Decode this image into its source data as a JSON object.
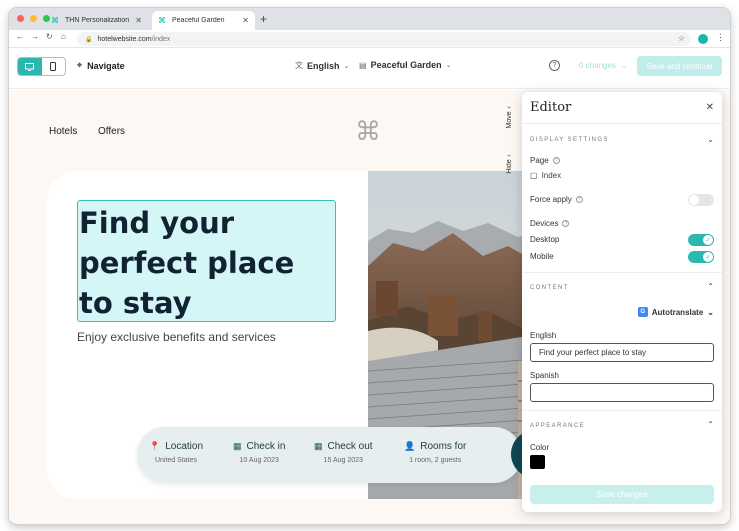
{
  "browser": {
    "tabs": [
      {
        "label": "THN Personalization",
        "favicon": "cmd-icon"
      },
      {
        "label": "Peaceful Garden",
        "favicon": "cmd-icon"
      }
    ],
    "url_host": "hotelwebsite.com",
    "url_path": "/index"
  },
  "appbar": {
    "navigate_label": "Navigate",
    "language": "English",
    "site": "Peaceful Garden",
    "changes_label": "0 changes",
    "save_continue_label": "Save and continue",
    "accent_color": "#29b7b0"
  },
  "site": {
    "menu": [
      "Hotels",
      "Offers"
    ],
    "logo_glyph": "⌘",
    "hero_title": "Find your perfect place to stay",
    "hero_subtitle": "Enjoy exclusive benefits and services",
    "booking": [
      {
        "label": "Location",
        "value": "United States",
        "icon": "pin-icon"
      },
      {
        "label": "Check in",
        "value": "10 Aug 2023",
        "icon": "calendar-icon"
      },
      {
        "label": "Check out",
        "value": "15 Aug 2023",
        "icon": "calendar-icon"
      },
      {
        "label": "Rooms for",
        "value": "1 room, 2 guests",
        "icon": "person-icon"
      }
    ],
    "edge_tabs": {
      "move": "Move",
      "hide": "Hide"
    }
  },
  "editor": {
    "title": "Editor",
    "display_settings_title": "DISPLAY SETTINGS",
    "page_label": "Page",
    "page_value": "Index",
    "force_apply_label": "Force apply",
    "force_apply_on": false,
    "devices_label": "Devices",
    "desktop_label": "Desktop",
    "desktop_on": true,
    "mobile_label": "Mobile",
    "mobile_on": true,
    "content_title": "CONTENT",
    "autotranslate_label": "Autotranslate",
    "english_label": "English",
    "english_value": "Find your perfect place to stay",
    "spanish_label": "Spanish",
    "spanish_value": "",
    "appearance_title": "APPEARANCE",
    "color_label": "Color",
    "color_value": "#000000",
    "save_label": "Save changes"
  }
}
